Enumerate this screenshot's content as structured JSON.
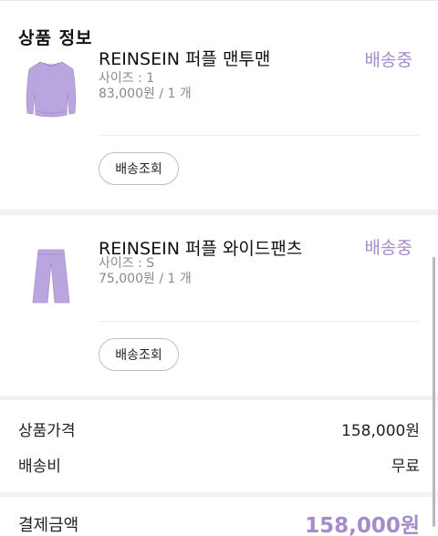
{
  "section": {
    "title": "상품 정보"
  },
  "products": [
    {
      "name": "REINSEIN 퍼플 맨투맨",
      "status": "배송중",
      "option": "사이즈 : 1",
      "price": "83,000원 / 1 개",
      "track_label": "배송조회",
      "thumbnail_icon": "sweatshirt-icon"
    },
    {
      "name": "REINSEIN 퍼플 와이드팬츠",
      "status": "배송중",
      "option": "사이즈 : S",
      "price": "75,000원 / 1 개",
      "track_label": "배송조회",
      "thumbnail_icon": "wide-pants-icon"
    }
  ],
  "summary": {
    "product_price_label": "상품가격",
    "product_price_value": "158,000원",
    "shipping_label": "배송비",
    "shipping_value": "무료",
    "total_label": "결제금액",
    "total_value": "158,000원"
  },
  "colors": {
    "accent": "#a58bc9",
    "product_purple": "#b9a6de"
  }
}
